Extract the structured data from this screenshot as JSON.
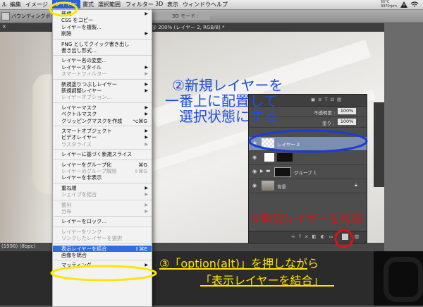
{
  "menubar": {
    "items": [
      "ル",
      "編集",
      "イメージ",
      "レイヤー",
      "書式",
      "選択範囲",
      "フィルター",
      "3D",
      "表示",
      "ウィンドウ",
      "ヘルプ"
    ],
    "active": "レイヤー",
    "right_status": "55°C\n3970rpm"
  },
  "options_bar": {
    "label": "バウンディングボックス",
    "mode_label": "3D モード :"
  },
  "document": {
    "tab_title": "@ 200% (レイヤー 2, RGB/8) *",
    "status": "(1998) (8bpc)"
  },
  "layer_menu": {
    "items": [
      {
        "label": "新規",
        "arrow": true,
        "group": 0
      },
      {
        "label": "CSS をコピー",
        "group": 0
      },
      {
        "label": "レイヤーを複製...",
        "group": 0
      },
      {
        "label": "削除",
        "arrow": true,
        "group": 0
      },
      {
        "sep": true
      },
      {
        "label": "PNG としてクイック書き出し",
        "group": 1
      },
      {
        "label": "書き出し形式...",
        "group": 1
      },
      {
        "sep": true
      },
      {
        "label": "レイヤー名の変更...",
        "group": 2
      },
      {
        "label": "レイヤースタイル",
        "arrow": true,
        "group": 2
      },
      {
        "label": "スマートフィルター",
        "arrow": true,
        "disabled": true,
        "group": 2
      },
      {
        "sep": true
      },
      {
        "label": "新規塗りつぶしレイヤー",
        "arrow": true,
        "group": 3
      },
      {
        "label": "新規調整レイヤー",
        "arrow": true,
        "group": 3
      },
      {
        "label": "レイヤーオプション...",
        "disabled": true,
        "group": 3
      },
      {
        "sep": true
      },
      {
        "label": "レイヤーマスク",
        "arrow": true,
        "group": 4
      },
      {
        "label": "ベクトルマスク",
        "arrow": true,
        "group": 4
      },
      {
        "label": "クリッピングマスクを作成",
        "shortcut": "⌥⌘G",
        "group": 4
      },
      {
        "sep": true
      },
      {
        "label": "スマートオブジェクト",
        "arrow": true,
        "group": 5
      },
      {
        "label": "ビデオレイヤー",
        "arrow": true,
        "group": 5
      },
      {
        "label": "ラスタライズ",
        "arrow": true,
        "disabled": true,
        "group": 5
      },
      {
        "sep": true
      },
      {
        "label": "レイヤーに基づく新規スライス",
        "group": 6
      },
      {
        "sep": true
      },
      {
        "label": "レイヤーをグループ化",
        "shortcut": "⌘G",
        "group": 7
      },
      {
        "label": "レイヤーのグループ解除",
        "shortcut": "⇧⌘G",
        "disabled": true,
        "group": 7
      },
      {
        "label": "レイヤーを非表示",
        "group": 7
      },
      {
        "sep": true
      },
      {
        "label": "重ね順",
        "arrow": true,
        "group": 8
      },
      {
        "label": "シェイプを結合",
        "arrow": true,
        "disabled": true,
        "group": 8
      },
      {
        "sep": true
      },
      {
        "label": "整列",
        "arrow": true,
        "disabled": true,
        "group": 9
      },
      {
        "label": "分布",
        "arrow": true,
        "disabled": true,
        "group": 9
      },
      {
        "sep": true
      },
      {
        "label": "レイヤーをロック...",
        "group": 10
      },
      {
        "sep": true
      },
      {
        "label": "レイヤーをリンク",
        "disabled": true,
        "group": 11
      },
      {
        "label": "リンクしたレイヤーを選択",
        "disabled": true,
        "group": 11
      },
      {
        "sep": true
      },
      {
        "label": "表示レイヤーを結合",
        "shortcut": "⇧⌘E",
        "highlighted": true,
        "group": 12
      },
      {
        "label": "画像を統合",
        "group": 12
      },
      {
        "sep": true
      },
      {
        "label": "マッティング",
        "arrow": true,
        "group": 13
      }
    ]
  },
  "layers_panel": {
    "opacity_label": "不透明度 :",
    "opacity_value": "100%",
    "fill_label": "塗り :",
    "fill_value": "100%",
    "layers": [
      {
        "name": "レイヤー 2",
        "selected": true
      },
      {
        "name": "",
        "selected": false
      },
      {
        "name": "グループ 1",
        "selected": false,
        "group": true
      },
      {
        "name": "背景",
        "selected": false,
        "locked": true
      }
    ]
  },
  "annotations": {
    "step2_line1": "②新規レイヤーを",
    "step2_line2": "一番上に配置して",
    "step2_line3": "選択状態にする",
    "step1": "①新規レイヤーを作成",
    "step3_line1": "③「option(alt)」を押しながら",
    "step3_line2": "「表示レイヤーを結合」",
    "colors": {
      "step2_text": "#1f4fd8",
      "step1_text": "#e01010",
      "step3_text": "#ffe400",
      "ellipse_blue": "#1a3cd8",
      "ellipse_yellow": "#ffe600",
      "circle_red": "#e01010"
    }
  }
}
